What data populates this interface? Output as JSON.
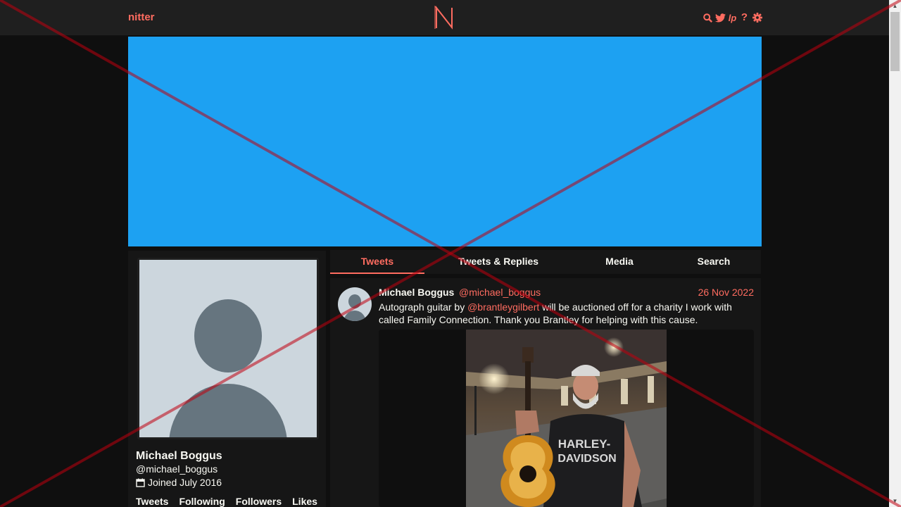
{
  "nav": {
    "brand": "nitter",
    "icons": [
      "search-icon",
      "twitter-bird-icon",
      "liberapay-icon",
      "help-icon",
      "settings-gear-icon"
    ],
    "help_label": "?",
    "liberapay_label": "lp"
  },
  "colors": {
    "accent": "#ff6c60",
    "banner": "#1da1f2",
    "background": "#0f0f0f",
    "panel": "#161616"
  },
  "profile": {
    "fullname": "Michael Boggus",
    "username": "@michael_boggus",
    "joined": "Joined July 2016",
    "stats": [
      "Tweets",
      "Following",
      "Followers",
      "Likes"
    ]
  },
  "tabs": [
    "Tweets",
    "Tweets & Replies",
    "Media",
    "Search"
  ],
  "tweet": {
    "fullname": "Michael Boggus",
    "username": "@michael_boggus",
    "date": "26 Nov 2022",
    "text_before": "Autograph guitar by ",
    "mention": "@brantleygilbert",
    "text_after": " will be auctioned off for a charity I work with called Family Connection. Thank you Brantley for helping with this cause."
  }
}
